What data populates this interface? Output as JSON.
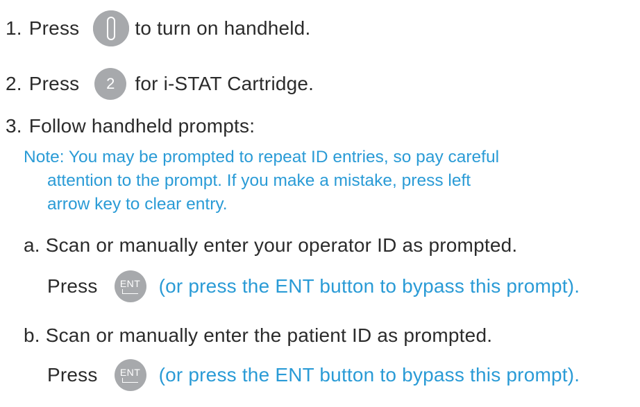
{
  "steps": {
    "step1": {
      "number": "1.",
      "press": "Press",
      "rest": "to turn on handheld.",
      "icon": "power-icon"
    },
    "step2": {
      "number": "2.",
      "press": "Press",
      "key": "2",
      "rest": "for i-STAT Cartridge."
    },
    "step3": {
      "number": "3.",
      "text": "Follow handheld prompts:"
    }
  },
  "note": {
    "line1": "Note: You may be prompted to repeat ID entries, so pay careful",
    "line2": "attention to the prompt.  If you make a mistake,  press left",
    "line3": "arrow key to clear entry."
  },
  "substeps": {
    "a": {
      "text": "a.  Scan or manually enter your operator ID as prompted.",
      "press": "Press",
      "key": "ENT",
      "hint": "(or press the ENT button to bypass this prompt)."
    },
    "b": {
      "text": "b.  Scan or manually enter the patient ID as prompted.",
      "press": "Press",
      "key": "ENT",
      "hint": "(or press the ENT button to bypass this prompt)."
    }
  },
  "colors": {
    "text": "#2b2b2b",
    "note_blue": "#2a9bd6",
    "button_gray": "#a7a9ac"
  }
}
